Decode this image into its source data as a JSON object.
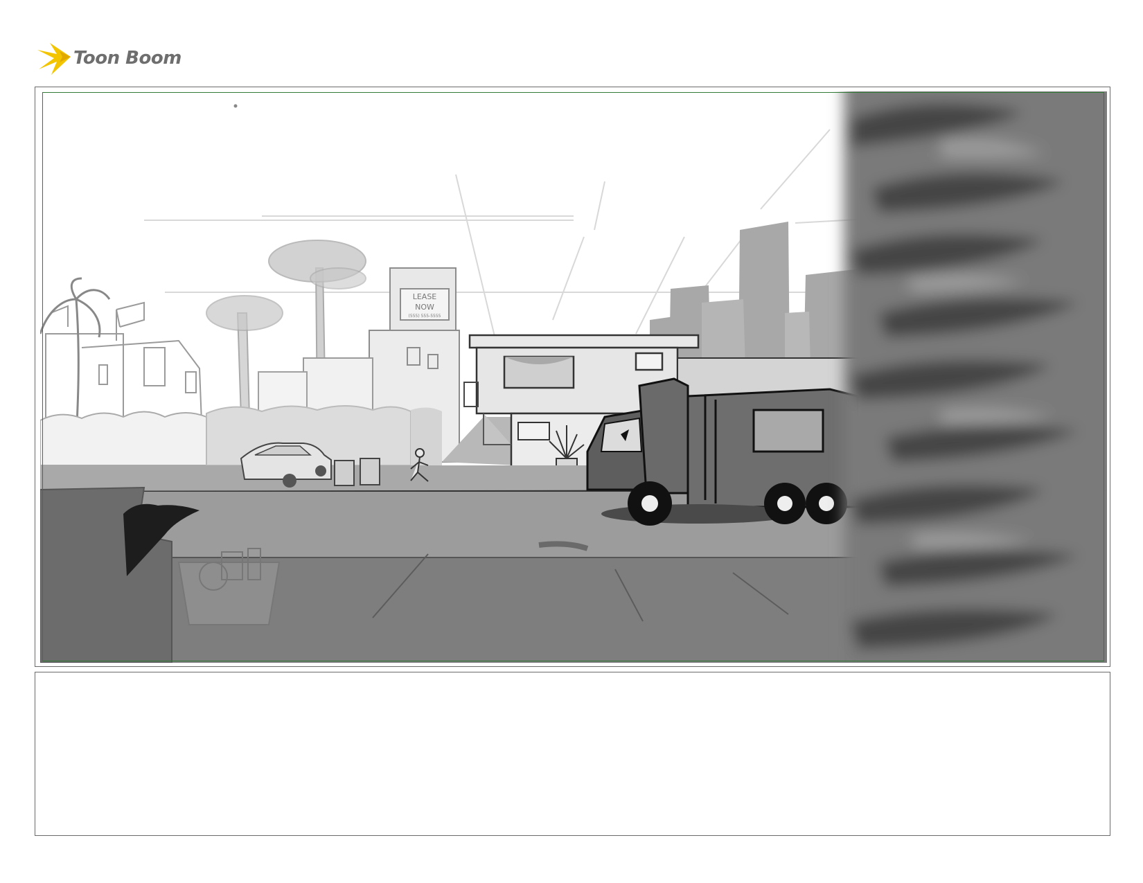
{
  "logo": {
    "text": "Toon Boom",
    "icon": "starburst-logo-icon",
    "accent_color": "#f2c500"
  },
  "panel": {
    "sign_line1": "LEASE",
    "sign_line2": "NOW",
    "sign_line3": "(555) 555-5555"
  },
  "caption": {
    "text": ""
  },
  "colors": {
    "safe_frame": "#2f7a35",
    "border": "#6a6a6a"
  }
}
